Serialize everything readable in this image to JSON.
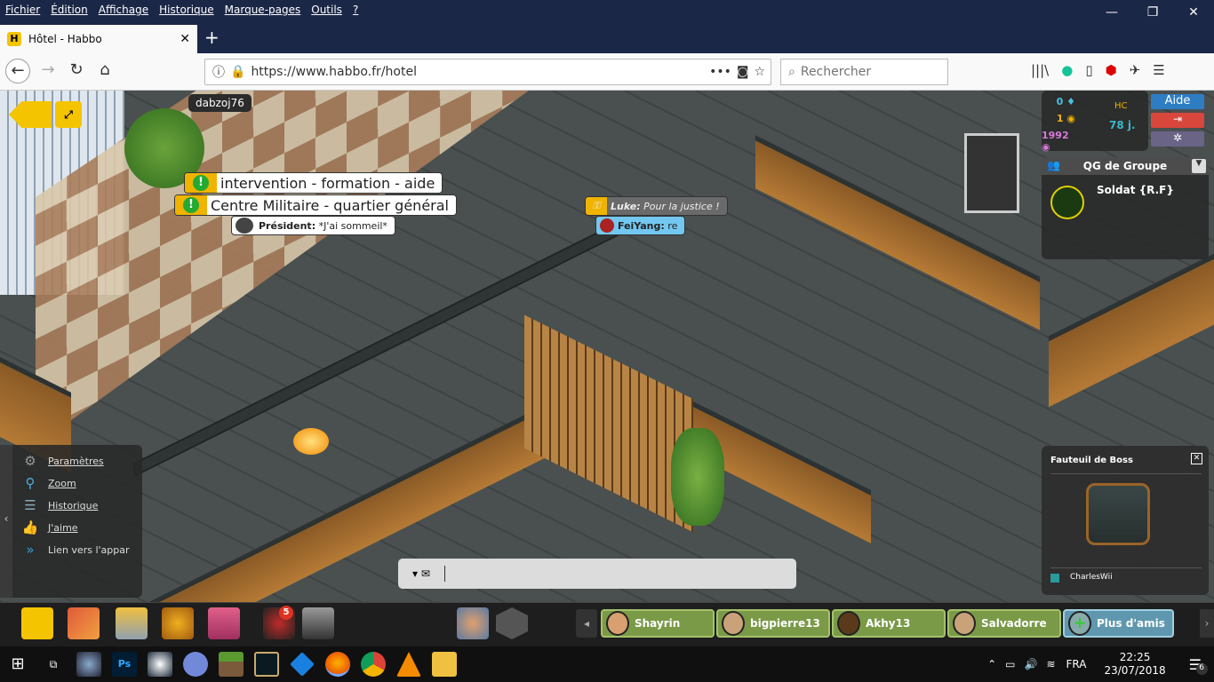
{
  "browser": {
    "menu": [
      "Fichier",
      "Édition",
      "Affichage",
      "Historique",
      "Marque-pages",
      "Outils",
      "?"
    ],
    "tab_title": "Hôtel - Habbo",
    "url": "https://www.habbo.fr/hotel",
    "search_placeholder": "Rechercher",
    "icons": [
      "library-icon",
      "grammarly-icon",
      "reader-icon",
      "adblock-icon",
      "extension-icon",
      "menu-icon"
    ]
  },
  "game": {
    "name_tag": "dabzoj76",
    "room_bubbles": [
      {
        "text": "intervention - formation - aide"
      },
      {
        "text": "Centre Militaire - quartier général"
      }
    ],
    "chat": [
      {
        "user": "Président:",
        "message": "*J'ai sommeil*"
      },
      {
        "user": "Luke:",
        "message": "Pour la justice !"
      },
      {
        "user": "FeiYang:",
        "message": "re"
      }
    ],
    "currency": {
      "diamonds": "0",
      "credits": "1",
      "duckets": "1992",
      "hc_days": "78 j."
    },
    "buttons": {
      "help": "Aide"
    },
    "group": {
      "header": "QG de Groupe",
      "name": "Soldat {R.F}"
    },
    "room_menu": [
      {
        "label": "Paramètres",
        "icon": "gear-icon"
      },
      {
        "label": "Zoom",
        "icon": "zoom-icon"
      },
      {
        "label": "Historique",
        "icon": "history-icon"
      },
      {
        "label": "J'aime",
        "icon": "thumbs-up-icon"
      },
      {
        "label": "Lien vers l'appar",
        "icon": "link-icon"
      }
    ],
    "furni_info": {
      "title": "Fauteuil de Boss",
      "owner": "CharlesWii"
    },
    "chat_input": {
      "value": ""
    },
    "toolbar_badge": "5",
    "friends": [
      "Shayrin",
      "bigpierre13",
      "Akhy13",
      "Salvadorre"
    ],
    "more_friends": "Plus d'amis",
    "colors": {
      "green": "#7a9a48",
      "blue_btn": "#2e7dc4",
      "red_btn": "#d9463c",
      "gear_btn": "#6a6486"
    }
  },
  "taskbar": {
    "lang": "FRA",
    "time": "22:25",
    "date": "23/07/2018",
    "notifications": "6"
  }
}
